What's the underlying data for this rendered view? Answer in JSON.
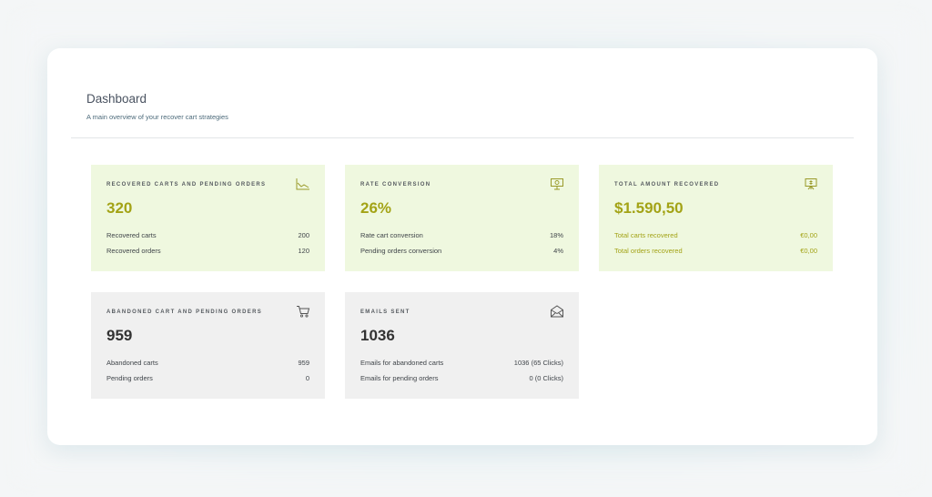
{
  "header": {
    "title": "Dashboard",
    "subtitle": "A main overview of your recover cart strategies"
  },
  "colors": {
    "accent_olive": "#a3a316",
    "card_green_bg": "#eff8df",
    "card_grey_bg": "#f0f0f0"
  },
  "cards": [
    {
      "title": "Recovered carts and pending orders",
      "icon": "line-chart-icon",
      "value": "320",
      "rows": [
        {
          "label": "Recovered carts",
          "value": "200"
        },
        {
          "label": "Recovered orders",
          "value": "120"
        }
      ]
    },
    {
      "title": "Rate conversion",
      "icon": "presentation-board-icon",
      "value": "26%",
      "rows": [
        {
          "label": "Rate cart conversion",
          "value": "18%"
        },
        {
          "label": "Pending orders conversion",
          "value": "4%"
        }
      ]
    },
    {
      "title": "Total amount recovered",
      "icon": "money-board-icon",
      "value": "$1.590,50",
      "rows": [
        {
          "label": "Total carts recovered",
          "value": "€0,00"
        },
        {
          "label": "Total orders recovered",
          "value": "€0,00"
        }
      ]
    },
    {
      "title": "Abandoned cart and pending orders",
      "icon": "shopping-cart-icon",
      "value": "959",
      "rows": [
        {
          "label": "Abandoned carts",
          "value": "959"
        },
        {
          "label": "Pending orders",
          "value": "0"
        }
      ]
    },
    {
      "title": "Emails sent",
      "icon": "open-envelope-icon",
      "value": "1036",
      "rows": [
        {
          "label": "Emails for abandoned carts",
          "value": "1036 (65 Clicks)"
        },
        {
          "label": "Emails for pending orders",
          "value": "0 (0 Clicks)"
        }
      ]
    }
  ]
}
